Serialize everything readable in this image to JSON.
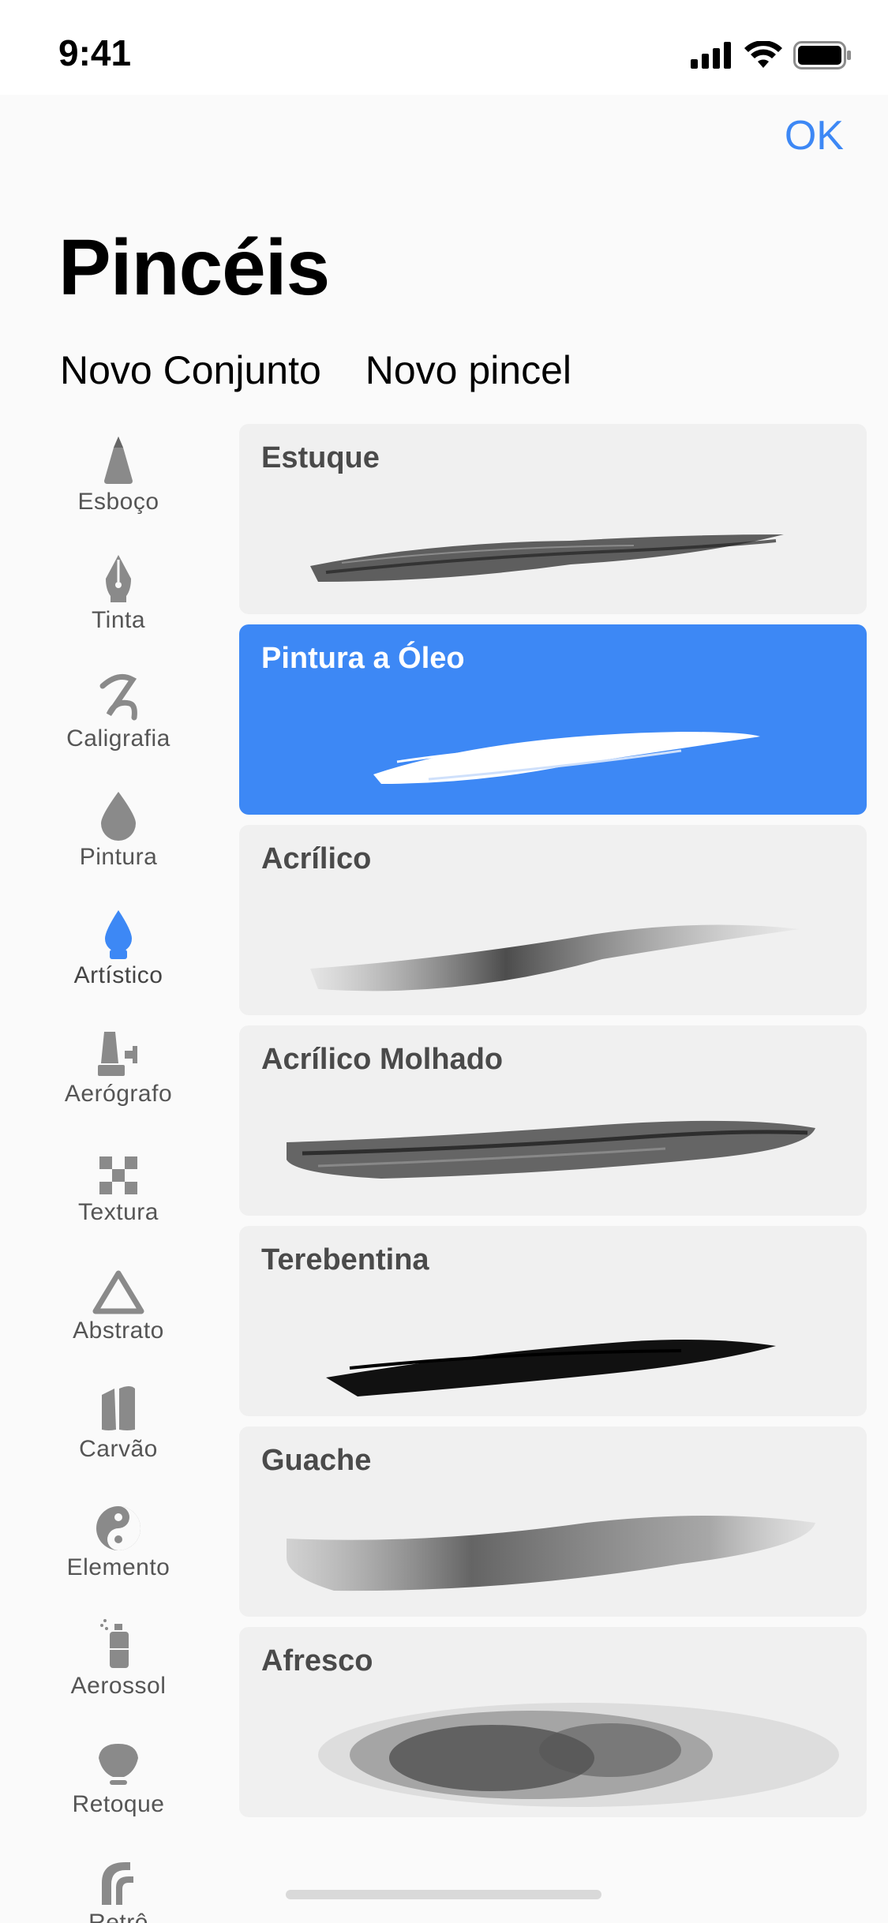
{
  "status_bar": {
    "time": "9:41"
  },
  "header": {
    "done_label": "OK",
    "title": "Pincéis"
  },
  "actions": {
    "new_set": "Novo Conjunto",
    "new_brush": "Novo pincel"
  },
  "categories": [
    {
      "label": "Esboço",
      "icon": "pencil-tip-icon"
    },
    {
      "label": "Tinta",
      "icon": "fountain-pen-icon"
    },
    {
      "label": "Caligrafia",
      "icon": "calligraphy-stroke-icon"
    },
    {
      "label": "Pintura",
      "icon": "paint-drop-icon"
    },
    {
      "label": "Artístico",
      "icon": "artistic-drop-icon",
      "active": true
    },
    {
      "label": "Aerógrafo",
      "icon": "airbrush-icon"
    },
    {
      "label": "Textura",
      "icon": "checker-texture-icon"
    },
    {
      "label": "Abstrato",
      "icon": "triangle-icon"
    },
    {
      "label": "Carvão",
      "icon": "charcoal-icon"
    },
    {
      "label": "Elemento",
      "icon": "yin-yang-icon"
    },
    {
      "label": "Aerossol",
      "icon": "spray-can-icon"
    },
    {
      "label": "Retoque",
      "icon": "shell-icon"
    },
    {
      "label": "Retrô",
      "icon": "retro-arch-icon"
    }
  ],
  "brushes": [
    {
      "name": "Estuque"
    },
    {
      "name": "Pintura a Óleo",
      "selected": true
    },
    {
      "name": "Acrílico"
    },
    {
      "name": "Acrílico Molhado"
    },
    {
      "name": "Terebentina"
    },
    {
      "name": "Guache"
    },
    {
      "name": "Afresco"
    }
  ],
  "colors": {
    "accent": "#3d88f5",
    "card": "#f0f0f0",
    "label": "#555555"
  }
}
